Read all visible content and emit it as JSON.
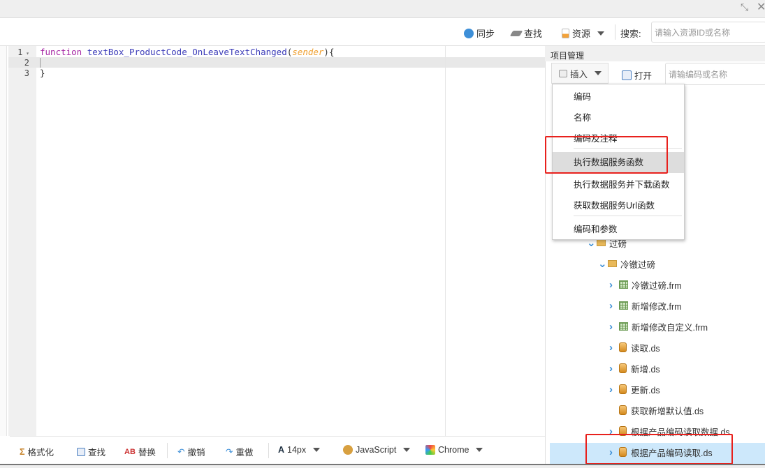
{
  "window": {
    "restore_icon": "compress-icon",
    "close_icon": "close-icon"
  },
  "toolbar": {
    "sync": "同步",
    "find": "查找",
    "resource": "资源",
    "search_label": "搜索:",
    "search_placeholder": "请输入资源ID或名称"
  },
  "editor": {
    "lines": [
      "1",
      "2",
      "3"
    ],
    "code": {
      "keyword": "function",
      "name": "textBox_ProductCode_OnLeaveTextChanged",
      "open": "(",
      "param": "sender",
      "close": "){",
      "end": "}"
    }
  },
  "project": {
    "title": "项目管理",
    "insert": "插入",
    "open": "打开",
    "search_placeholder": "请输编码或名称",
    "menu": [
      "编码",
      "名称",
      "编码及注释",
      "执行数据服务函数",
      "执行数据服务并下载函数",
      "获取数据服务Url函数",
      "编码和参数"
    ],
    "tree": [
      {
        "label": "过磅",
        "type": "folder"
      },
      {
        "label": "冷镦过磅",
        "type": "folder"
      },
      {
        "label": "冷镦过磅.frm",
        "type": "form"
      },
      {
        "label": "新增修改.frm",
        "type": "form"
      },
      {
        "label": "新增修改自定义.frm",
        "type": "form"
      },
      {
        "label": "读取.ds",
        "type": "ds"
      },
      {
        "label": "新增.ds",
        "type": "ds"
      },
      {
        "label": "更新.ds",
        "type": "ds"
      },
      {
        "label": "获取新增默认值.ds",
        "type": "ds"
      },
      {
        "label": "根据产品编码读取数据.ds",
        "type": "ds"
      },
      {
        "label": "根据产品编码读取.ds",
        "type": "ds",
        "selected": true
      }
    ]
  },
  "bottom": {
    "format": "格式化",
    "find": "查找",
    "replace": "替换",
    "undo": "撤销",
    "redo": "重做",
    "font_size": "14px",
    "language": "JavaScript",
    "browser": "Chrome"
  },
  "colors": {
    "highlight_box": "#e8211d",
    "selected_row": "#cde8fb",
    "keyword": "#a626a4",
    "function_name": "#3a3ab8",
    "param": "#f0a030"
  }
}
